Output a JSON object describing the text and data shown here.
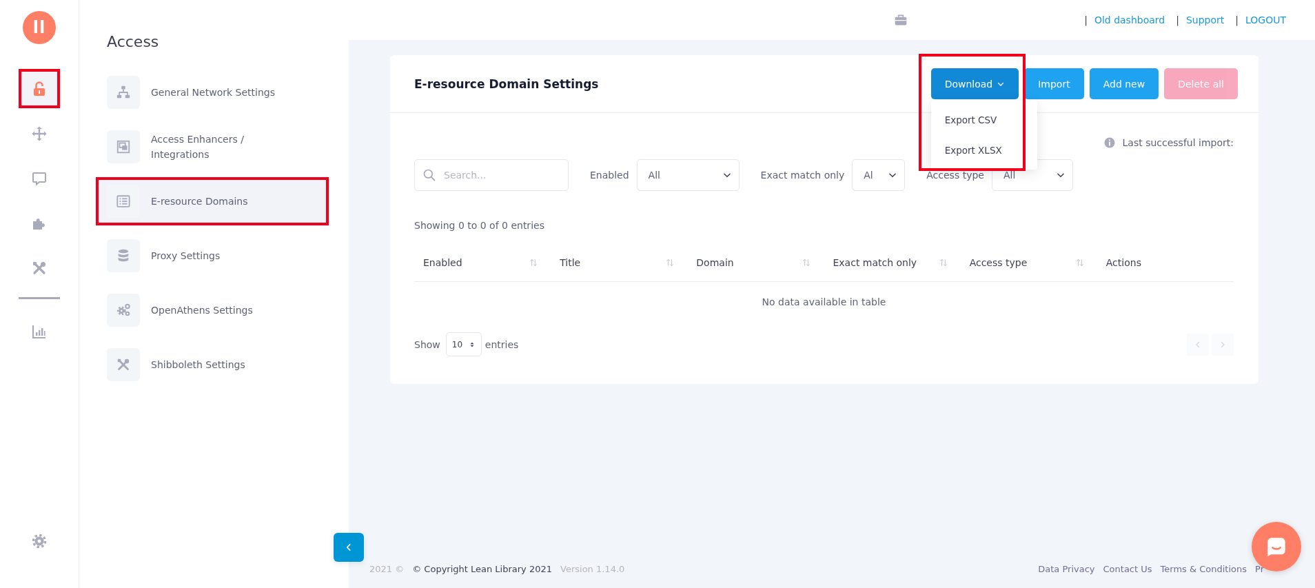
{
  "logo": {
    "text": "ll"
  },
  "rail": {
    "items": [
      {
        "selected": true,
        "highlighted": true
      },
      {
        "selected": false,
        "highlighted": false
      },
      {
        "selected": false,
        "highlighted": false
      },
      {
        "selected": false,
        "highlighted": false
      },
      {
        "selected": false,
        "highlighted": false
      },
      {
        "selected": false,
        "highlighted": false
      }
    ]
  },
  "sidebar": {
    "title": "Access",
    "items": [
      {
        "label": "General Network Settings",
        "selected": false,
        "highlighted": false
      },
      {
        "label": "Access Enhancers / Integrations",
        "selected": false,
        "highlighted": false
      },
      {
        "label": "E-resource Domains",
        "selected": true,
        "highlighted": true
      },
      {
        "label": "Proxy Settings",
        "selected": false,
        "highlighted": false
      },
      {
        "label": "OpenAthens Settings",
        "selected": false,
        "highlighted": false
      },
      {
        "label": "Shibboleth Settings",
        "selected": false,
        "highlighted": false
      }
    ]
  },
  "header": {
    "links": [
      {
        "separator": "|",
        "label": "Old dashboard"
      },
      {
        "separator": "|",
        "label": "Support"
      },
      {
        "separator": "|",
        "label": "LOGOUT"
      }
    ]
  },
  "card": {
    "title": "E-resource Domain Settings",
    "buttons": [
      {
        "label": "Download",
        "kind": "dropdown",
        "disabled": false,
        "expanded": true,
        "highlighted": true,
        "menu": [
          "Export CSV",
          "Export XLSX"
        ]
      },
      {
        "label": "Import",
        "kind": "info",
        "disabled": false
      },
      {
        "label": "Add new",
        "kind": "info",
        "disabled": false
      },
      {
        "label": "Delete all",
        "kind": "danger",
        "disabled": true
      }
    ],
    "import_note": "Last successful import:",
    "search": {
      "placeholder": "Search..."
    },
    "filters": [
      {
        "label": "Enabled",
        "value": "All"
      },
      {
        "label": "Exact match only",
        "value": "Al"
      },
      {
        "label": "Access type",
        "value": "All"
      }
    ],
    "info": "Showing 0 to 0 of 0 entries",
    "table": {
      "columns": [
        {
          "label": "Enabled",
          "sortable": true
        },
        {
          "label": "Title",
          "sortable": true
        },
        {
          "label": "Domain",
          "sortable": true
        },
        {
          "label": "Exact match only",
          "sortable": true
        },
        {
          "label": "Access type",
          "sortable": true
        },
        {
          "label": "Actions",
          "sortable": false
        }
      ],
      "empty": "No data available in table"
    },
    "length": {
      "before": "Show",
      "value": "10",
      "after": "entries"
    },
    "pagination": [
      {
        "kind": "prev",
        "disabled": true
      },
      {
        "kind": "next",
        "disabled": true
      }
    ]
  },
  "footer": {
    "left": [
      {
        "text": "2021 ©",
        "muted": true
      },
      {
        "text": "© Copyright Lean Library 2021",
        "muted": false
      },
      {
        "text": "Version 1.14.0",
        "muted": true
      }
    ],
    "links": [
      "Data Privacy",
      "Contact Us",
      "Terms & Conditions",
      "Pr"
    ]
  }
}
